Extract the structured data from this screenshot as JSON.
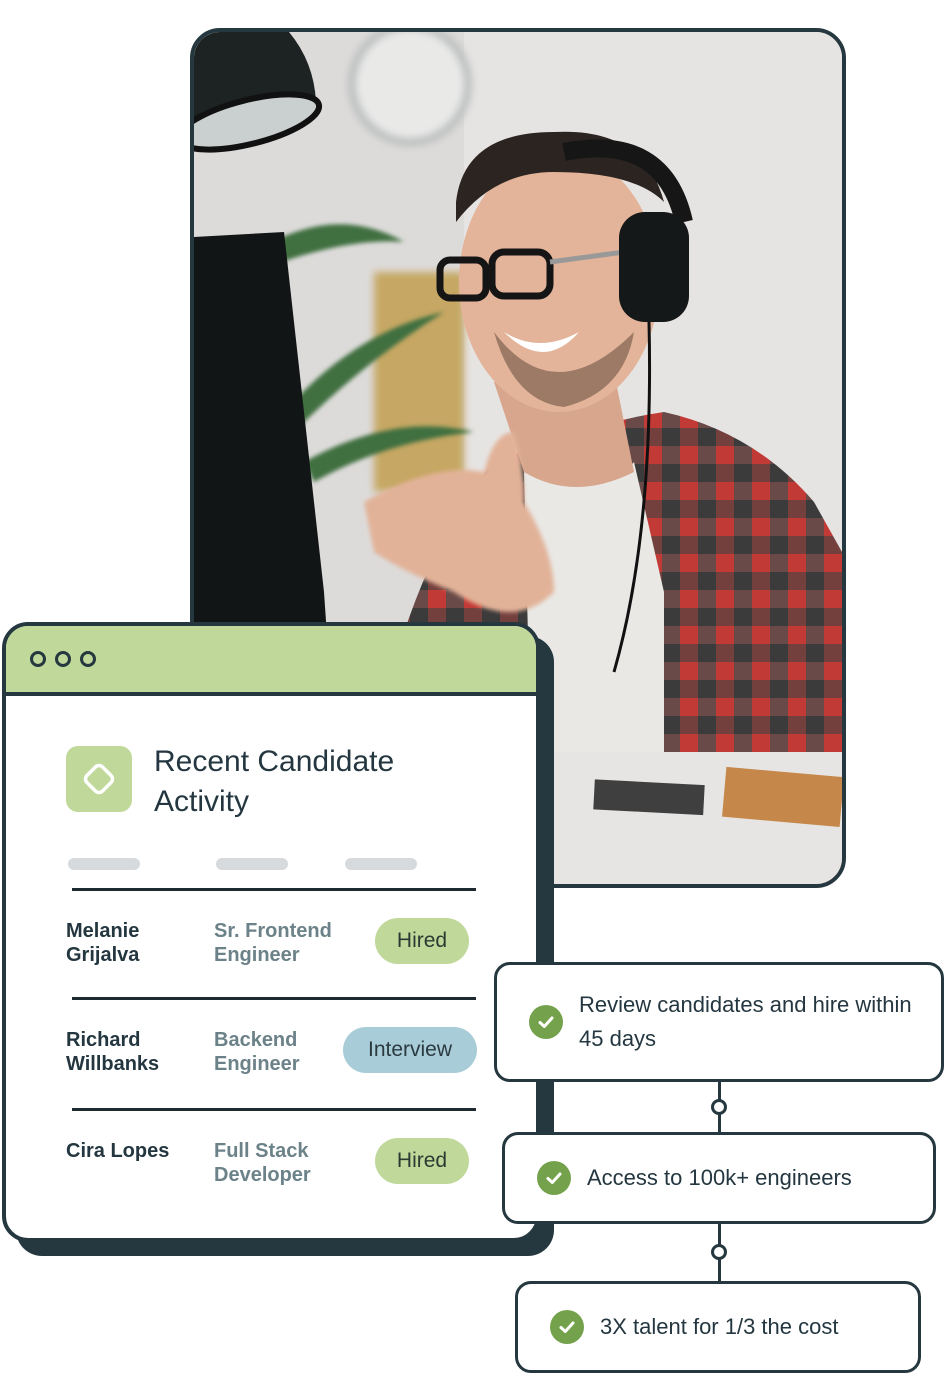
{
  "photo": {
    "subject": "smiling man with glasses and headset at computer, red plaid shirt",
    "icon": "photo-image"
  },
  "card": {
    "window_controls": [
      "dot",
      "dot",
      "dot"
    ],
    "logo_icon": "diamond-icon",
    "title": "Recent Candidate Activity",
    "column_placeholders": 3,
    "rows": [
      {
        "name": "Melanie Grijalva",
        "role": "Sr. Frontend Engineer",
        "status": "Hired",
        "status_type": "hired"
      },
      {
        "name": "Richard Willbanks",
        "role": "Backend Engineer",
        "status": "Interview",
        "status_type": "interview"
      },
      {
        "name": "Cira Lopes",
        "role": "Full Stack Developer",
        "status": "Hired",
        "status_type": "hired"
      }
    ]
  },
  "colors": {
    "dark": "#26383f",
    "green_light": "#c0d89a",
    "blue_light": "#a8ccd8",
    "check_green": "#74a24c",
    "muted_text": "#6c8289"
  },
  "benefits": [
    {
      "text": "Review candidates and hire within 45 days",
      "icon": "check-circle-icon"
    },
    {
      "text": "Access to 100k+ engineers",
      "icon": "check-circle-icon"
    },
    {
      "text": "3X talent for 1/3 the cost",
      "icon": "check-circle-icon"
    }
  ]
}
